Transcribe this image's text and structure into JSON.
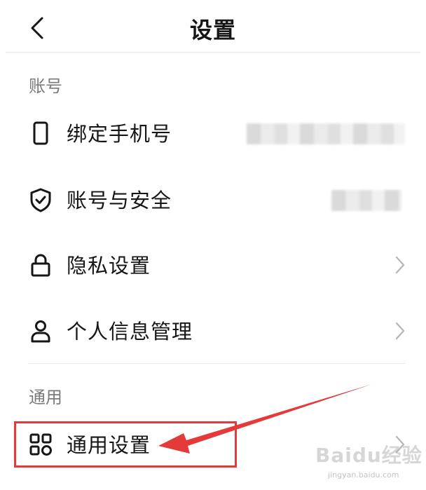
{
  "header": {
    "title": "设置"
  },
  "account_section": {
    "title": "账号",
    "items": [
      {
        "label": "绑定手机号",
        "value": "",
        "icon": "phone-icon"
      },
      {
        "label": "账号与安全",
        "value": "",
        "icon": "shield-check-icon"
      },
      {
        "label": "隐私设置",
        "icon": "lock-icon"
      },
      {
        "label": "个人信息管理",
        "icon": "person-icon"
      }
    ]
  },
  "general_section": {
    "title": "通用",
    "items": [
      {
        "label": "通用设置",
        "icon": "grid-icon"
      }
    ]
  },
  "annotation": {
    "color": "#e43a3a"
  },
  "watermark": {
    "text": "Baidu经验",
    "sub": "jingyan.baidu.com"
  }
}
